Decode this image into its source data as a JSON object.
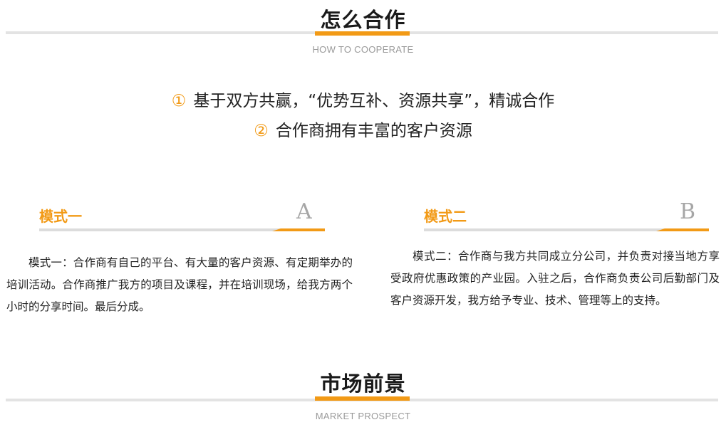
{
  "cooperate": {
    "title": "怎么合作",
    "subtitle": "HOW TO COOPERATE",
    "points": [
      {
        "num": "①",
        "text": "基于双方共赢，“优势互补、资源共享”，精诚合作"
      },
      {
        "num": "②",
        "text": "合作商拥有丰富的客户资源"
      }
    ]
  },
  "modes": [
    {
      "title": "模式一",
      "letter": "A",
      "text": "模式一：合作商有自己的平台、有大量的客户资源、有定期举办的培训活动。合作商推广我方的项目及课程，并在培训现场，给我方两个小时的分享时间。最后分成。"
    },
    {
      "title": "模式二",
      "letter": "B",
      "text": "模式二：合作商与我方共同成立分公司，并负责对接当地方享受政府优惠政策的产业园。入驻之后，合作商负责公司后勤部门及客户资源开发，我方给予专业、技术、管理等上的支持。"
    }
  ],
  "market": {
    "title": "市场前景",
    "subtitle": "MARKET PROSPECT"
  },
  "colors": {
    "accent": "#f29a16",
    "rule": "#e3e3e3",
    "subtitle": "#9a9a9a"
  }
}
